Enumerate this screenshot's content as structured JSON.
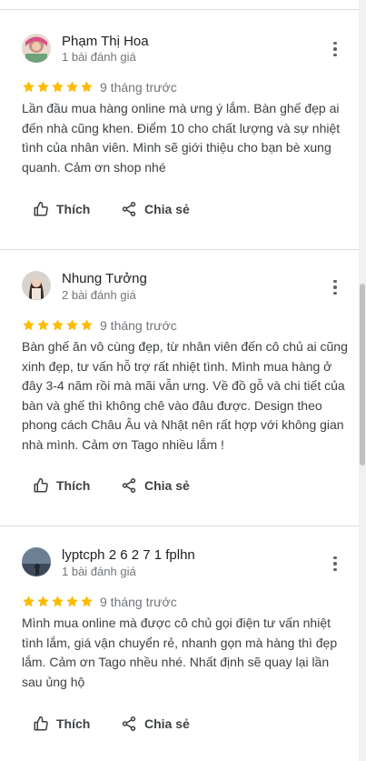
{
  "reviews": [
    {
      "name": "Phạm Thị Hoa",
      "review_count": "1 bài đánh giá",
      "rating": 5,
      "time": "9 tháng trước",
      "text_lines": [
        "Lần đầu mua hàng online mà ưng ý lắm. Bàn ghế đẹp ai",
        "đến nhà cũng khen. Điểm 10 cho chất lượng và sự nhiệt",
        "tình của nhân viên. Mình sẽ giới thiệu cho bạn bè xung",
        "quanh. Cảm ơn shop nhé"
      ],
      "like_label": "Thích",
      "share_label": "Chia sẻ"
    },
    {
      "name": "Nhung Tưởng",
      "review_count": "2 bài đánh giá",
      "rating": 5,
      "time": "9 tháng trước",
      "text_lines": [
        "Bàn ghế ăn vô cùng đẹp, từ nhân viên đến cô chủ ai cũng",
        "xinh đẹp, tư vấn hỗ trợ rất nhiệt tình. Mình mua hàng ở",
        "đây 3-4 năm rồi mà mãi vẫn ưng. Về đồ gỗ và chi tiết của",
        "bàn và ghế thì không chê vào đâu được. Design theo",
        "phong cách Châu Âu và Nhật nên rất hợp với không gian",
        "nhà mình. Cảm ơn Tago nhiều lắm !"
      ],
      "like_label": "Thích",
      "share_label": "Chia sẻ"
    },
    {
      "name": "lyptcph 2 6 2 7 1 fplhn",
      "review_count": "1 bài đánh giá",
      "rating": 5,
      "time": "9 tháng trước",
      "text_lines": [
        "Mình mua online mà được cô chủ gọi điện tư vấn nhiệt",
        "tình lắm, giá vận chuyển rẻ, nhanh gọn mà hàng thì đẹp",
        "lắm. Cảm ơn Tago nhều nhé. Nhất định sẽ quay lại lần",
        "sau ủng hộ"
      ],
      "like_label": "Thích",
      "share_label": "Chia sẻ"
    }
  ],
  "colors": {
    "star": "#fbbc04",
    "divider": "#dadce0",
    "secondary_text": "#70757a",
    "body_text": "#3c4043"
  },
  "icons": [
    "more-vert-icon",
    "star-icon",
    "thumb-up-icon",
    "share-icon"
  ]
}
